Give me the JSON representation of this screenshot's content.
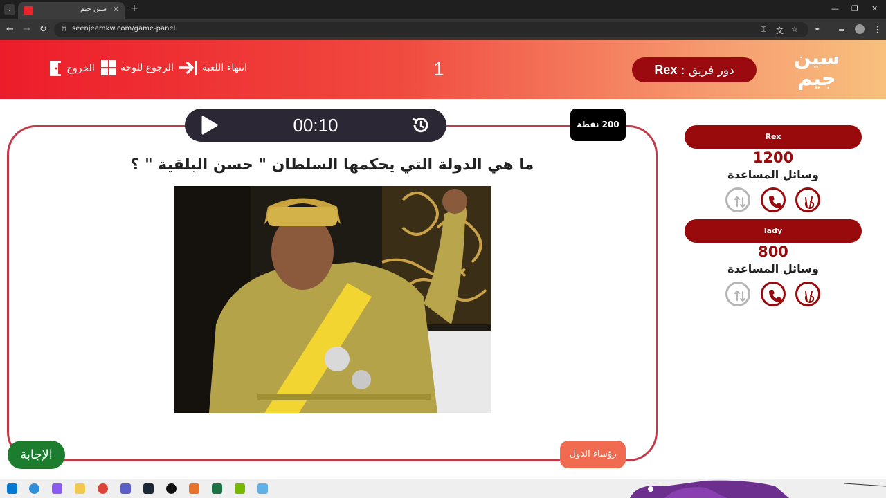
{
  "browser": {
    "tab_title": "سين جيم",
    "url": "seenjeemkw.com/game-panel",
    "tab_close": "✕",
    "tab_new": "+"
  },
  "header": {
    "logo_line1": "سين",
    "logo_line2": "جيم",
    "turn_label": "دور فريق : ",
    "turn_team": "Rex",
    "round_number": "1",
    "end_game": "انتهاء اللعبة",
    "back_to_board": "الرجوع للوحة",
    "exit": "الخروج"
  },
  "game": {
    "timer": "00:10",
    "points": "200 نقطة",
    "question": "ما هي الدولة التي يحكمها السلطان \" حسن البلقية \" ؟",
    "category": "رؤساء الدول",
    "answer_button": "الإجابة"
  },
  "teams": [
    {
      "name": "Rex",
      "score": "1200",
      "aids_label": "وسائل المساعدة",
      "aids": [
        {
          "icon": "two-fingers-icon",
          "active": true
        },
        {
          "icon": "phone-icon",
          "active": true
        },
        {
          "icon": "swap-icon",
          "active": false
        }
      ]
    },
    {
      "name": "lady",
      "score": "800",
      "aids_label": "وسائل المساعدة",
      "aids": [
        {
          "icon": "two-fingers-icon",
          "active": true
        },
        {
          "icon": "phone-icon",
          "active": true
        },
        {
          "icon": "swap-icon",
          "active": false
        }
      ]
    }
  ],
  "colors": {
    "brand_red": "#ed1c2a",
    "dark_red": "#980a0b",
    "card_border": "#c23a49",
    "timer_bg": "#2b2735",
    "answer_green": "#1c7d2f",
    "category_orange": "#f06b4f"
  }
}
